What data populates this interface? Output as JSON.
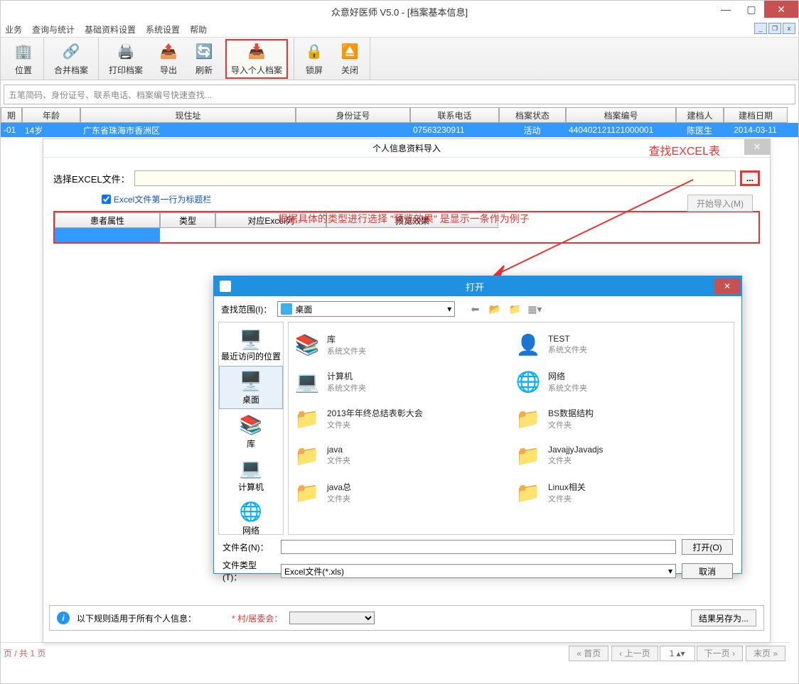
{
  "titlebar": {
    "title": "众意好医师 V5.0 - [档案基本信息]"
  },
  "menu": {
    "m0": "业务",
    "m1": "查询与统计",
    "m2": "基础资料设置",
    "m3": "系统设置",
    "m4": "帮助"
  },
  "toolbar": {
    "t0": "位置",
    "t1": "合并档案",
    "t2": "打印档案",
    "t3": "导出",
    "t4": "刷新",
    "t5": "导入个人档案",
    "t6": "锁屏",
    "t7": "关闭"
  },
  "search": {
    "placeholder": "五笔简码、身份证号、联系电话、档案编号快速查找..."
  },
  "grid": {
    "h0": "期",
    "h1": "年龄",
    "h2": "现住址",
    "h3": "身份证号",
    "h4": "联系电话",
    "h5": "档案状态",
    "h6": "档案编号",
    "h7": "建档人",
    "h8": "建档日期",
    "r": {
      "c0": "-01",
      "c1": "14岁",
      "c2": "广东省珠海市香洲区",
      "c3": "",
      "c4": "07563230911",
      "c5": "活动",
      "c6": "440402121121000001",
      "c7": "陈医生",
      "c8": "2014-03-11"
    }
  },
  "import": {
    "title": "个人信息资料导入",
    "annotExcel": "查找EXCEL表",
    "lblFile": "选择EXCEL文件：",
    "chk": "Excel文件第一行为标题栏",
    "btnStart": "开始导入(M)",
    "annotRed": "根据具体的类型进行选择   \"预览效果\" 是显示一条作为例子",
    "mh0": "患者属性",
    "mh1": "类型",
    "mh2": "对应Excel列",
    "mh3": "预览效果",
    "footerText": "以下规则适用于所有个人信息：",
    "reqLabel": "* 村/居委会：",
    "btnSave": "结果另存为..."
  },
  "open": {
    "title": "打开",
    "lblRange": "查找范围(I)：",
    "comboVal": "桌面",
    "side": {
      "s0": "最近访问的位置",
      "s1": "桌面",
      "s2": "库",
      "s3": "计算机",
      "s4": "网络"
    },
    "items": [
      {
        "n": "库",
        "s": "系统文件夹",
        "i": "📚"
      },
      {
        "n": "TEST",
        "s": "系统文件夹",
        "i": "👤"
      },
      {
        "n": "计算机",
        "s": "系统文件夹",
        "i": "💻"
      },
      {
        "n": "网络",
        "s": "系统文件夹",
        "i": "🌐"
      },
      {
        "n": "2013年年终总结表彰大会",
        "s": "文件夹",
        "i": "📁"
      },
      {
        "n": "BS数据结构",
        "s": "文件夹",
        "i": "📁"
      },
      {
        "n": "java",
        "s": "文件夹",
        "i": "📁"
      },
      {
        "n": "JavajjyJavadjs",
        "s": "文件夹",
        "i": "📁"
      },
      {
        "n": "java总",
        "s": "文件夹",
        "i": "📁"
      },
      {
        "n": "Linux相关",
        "s": "文件夹",
        "i": "📁"
      }
    ],
    "lblName": "文件名(N)：",
    "lblType": "文件类型(T)：",
    "typeVal": "Excel文件(*.xls)",
    "btnOpen": "打开(O)",
    "btnCancel": "取消"
  },
  "pager": {
    "left": "页 / 共 1 页",
    "first": "« 首页",
    "prev": "‹ 上一页",
    "num": "1",
    "next": "下一页 ›",
    "last": "末页 »"
  }
}
